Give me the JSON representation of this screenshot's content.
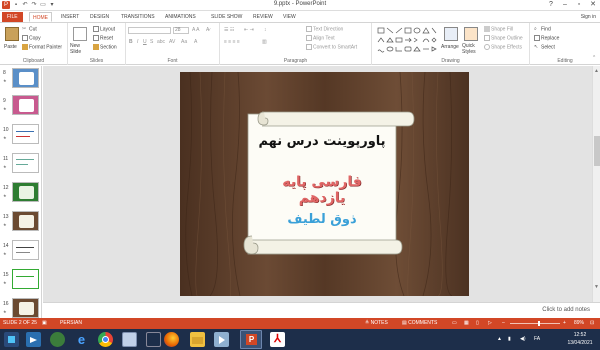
{
  "window": {
    "title": "9.pptx - PowerPoint"
  },
  "tabs": [
    "FILE",
    "HOME",
    "INSERT",
    "DESIGN",
    "TRANSITIONS",
    "ANIMATIONS",
    "SLIDE SHOW",
    "REVIEW",
    "VIEW"
  ],
  "active_tab": "HOME",
  "signin": "Sign in",
  "ribbon": {
    "clipboard": {
      "paste": "Paste",
      "cut": "Cut",
      "copy": "Copy",
      "format_painter": "Format Painter",
      "label": "Clipboard"
    },
    "slides": {
      "new_slide": "New Slide",
      "layout": "Layout",
      "reset": "Reset",
      "section": "Section",
      "label": "Slides"
    },
    "font": {
      "size": "28",
      "label": "Font"
    },
    "paragraph": {
      "text_direction": "Text Direction",
      "align_text": "Align Text",
      "convert_smartart": "Convert to SmartArt",
      "label": "Paragraph"
    },
    "drawing": {
      "arrange": "Arrange",
      "quick_styles": "Quick Styles",
      "shape_fill": "Shape Fill",
      "shape_outline": "Shape Outline",
      "shape_effects": "Shape Effects",
      "label": "Drawing"
    },
    "editing": {
      "find": "Find",
      "replace": "Replace",
      "select": "Select",
      "label": "Editing"
    }
  },
  "thumbnails": [
    "8",
    "9",
    "10",
    "11",
    "12",
    "13",
    "14",
    "15",
    "16"
  ],
  "slide": {
    "line1": "پاورپوینت درس نهم",
    "line2": "فارسی پایه یازدهم",
    "line3": "ذوق لطیف"
  },
  "notes_placeholder": "Click to add notes",
  "status": {
    "slide_of": "SLIDE 2 OF 25",
    "language": "PERSIAN",
    "notes": "NOTES",
    "comments": "COMMENTS",
    "zoom": "89%"
  },
  "taskbar": {
    "lang": "FA",
    "time": "12:52",
    "date": "13/04/2021"
  },
  "colors": {
    "accent": "#d24726",
    "line2": "#e06666",
    "line3": "#3aa0d8"
  }
}
